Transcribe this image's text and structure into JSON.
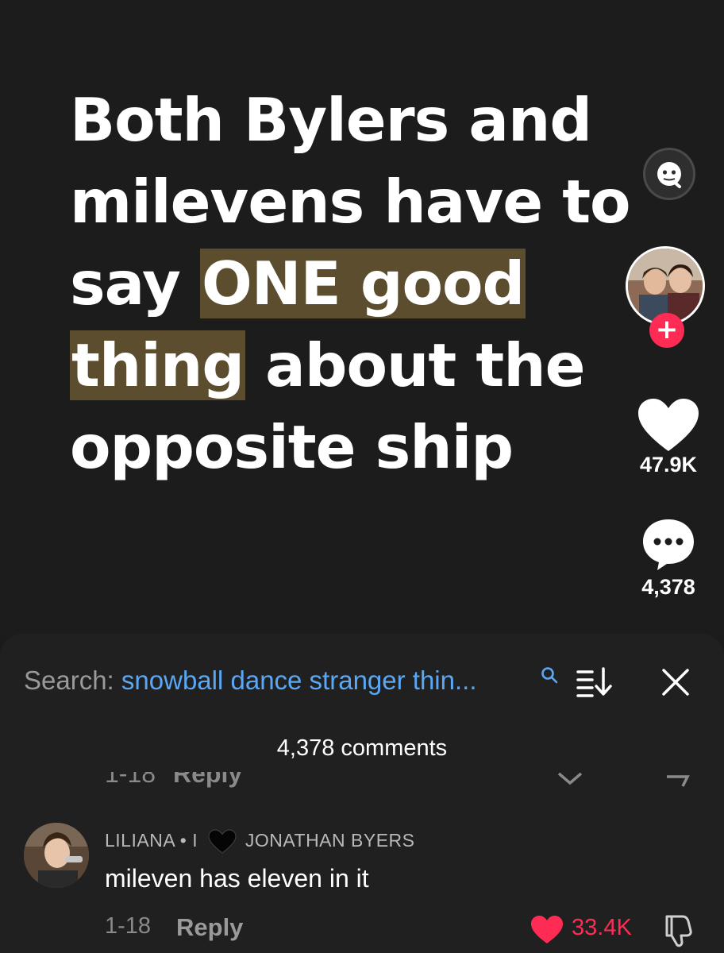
{
  "video": {
    "caption_lines": [
      {
        "parts": [
          {
            "text": "Both Bylers and",
            "highlight": false
          }
        ]
      },
      {
        "parts": [
          {
            "text": "milevens have to",
            "highlight": false
          }
        ]
      },
      {
        "parts": [
          {
            "text": "say ",
            "highlight": false
          },
          {
            "text": "ONE good",
            "highlight": true
          }
        ]
      },
      {
        "parts": [
          {
            "text": "thing",
            "highlight": true
          },
          {
            "text": " about the",
            "highlight": false
          }
        ]
      },
      {
        "parts": [
          {
            "text": "opposite ship",
            "highlight": false
          }
        ]
      }
    ],
    "highlight_color": "#5c4d2e"
  },
  "rail": {
    "follow_symbol": "+",
    "likes": "47.9K",
    "comments": "4,378",
    "accent_color": "#fe2c55"
  },
  "sheet": {
    "search_label": "Search: ",
    "search_query": "snowball dance stranger thin...",
    "comments_count": "4,378 comments",
    "ghost_time": "1-18",
    "ghost_reply": "Reply",
    "close_symbol": "✕"
  },
  "comment": {
    "user_prefix": "LILIANA • I",
    "user_suffix": "JONATHAN BYERS",
    "text": "mileven has eleven in it",
    "date": "1-18",
    "reply_label": "Reply",
    "likes": "33.4K"
  },
  "icons": {
    "caption_search": "face-search-icon",
    "like": "heart-icon",
    "comment": "comment-bubble-icon",
    "sort": "sort-icon",
    "close": "close-icon",
    "dislike": "dislike-icon",
    "black_heart": "black-heart-icon"
  }
}
